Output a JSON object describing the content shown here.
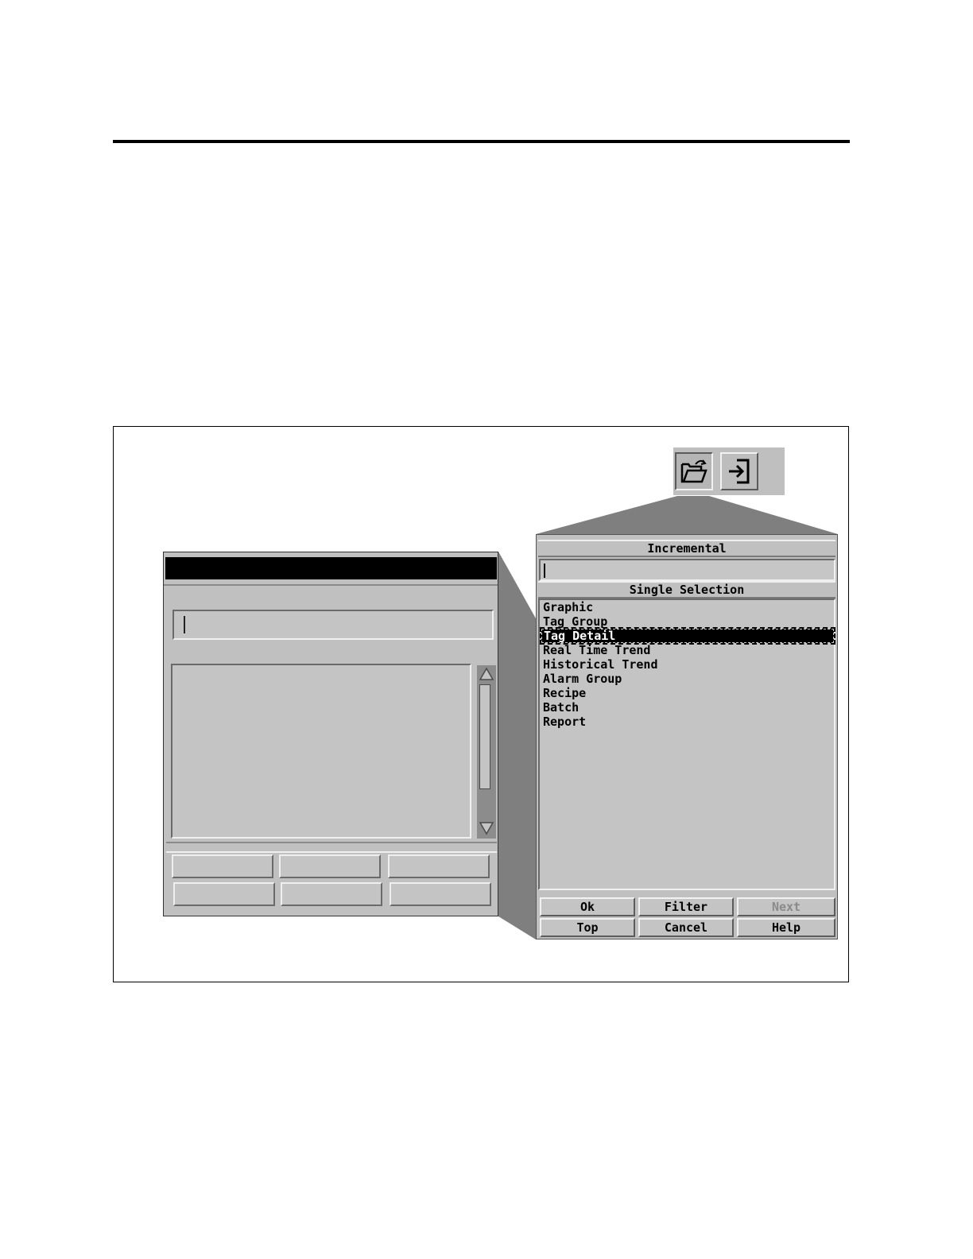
{
  "toolbar": {
    "open_icon": "folder-open-icon",
    "login_icon": "login-arrow-icon"
  },
  "select_dialog": {
    "incremental_label": "Incremental",
    "incremental_value": "",
    "selection_label": "Single Selection",
    "items": [
      "Graphic",
      "Tag Group",
      "Tag Detail",
      "Real Time Trend",
      "Historical Trend",
      "Alarm Group",
      "Recipe",
      "Batch",
      "Report"
    ],
    "selected_item": "Tag Detail",
    "buttons": {
      "ok": "Ok",
      "filter": "Filter",
      "next": "Next",
      "top": "Top",
      "cancel": "Cancel",
      "help": "Help"
    }
  },
  "colors": {
    "dialog_bg": "#c0c0c0",
    "title_bar": "#000000",
    "zoom_wedge": "#808080"
  }
}
